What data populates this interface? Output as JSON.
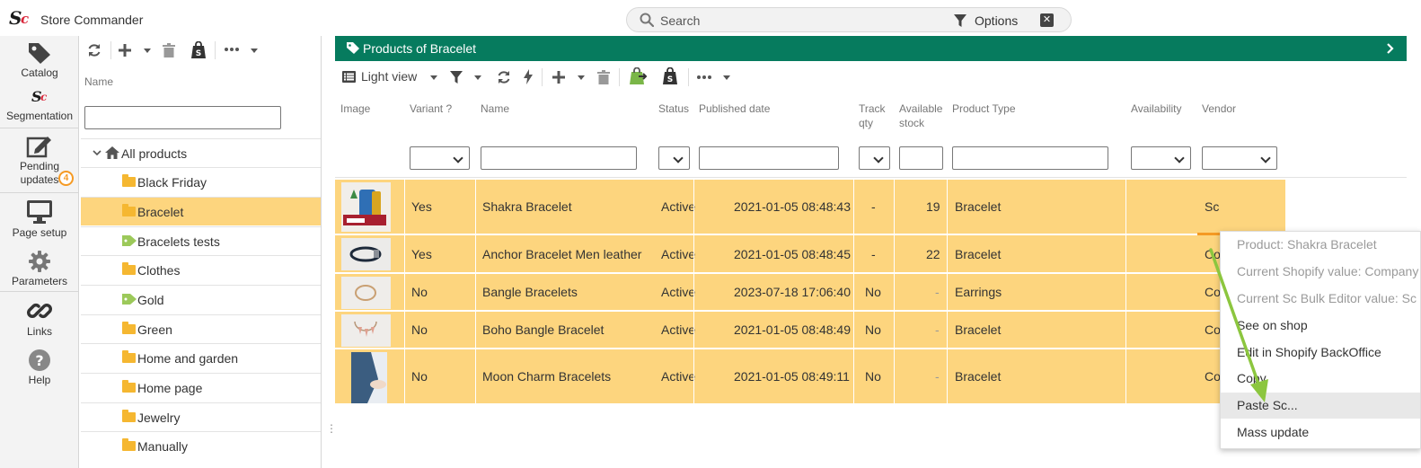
{
  "app": {
    "logo_s": "S",
    "logo_c": "c",
    "title": "Store Commander"
  },
  "search": {
    "placeholder": "Search",
    "options_label": "Options",
    "clear_glyph": "✕"
  },
  "rail": [
    {
      "label": "Catalog",
      "icon": "tag-icon"
    },
    {
      "label": "Segmentation",
      "icon": "sc-logo-icon"
    },
    {
      "label": "Pending updates",
      "icon": "edit-icon",
      "badge": "4"
    },
    {
      "label": "Page setup",
      "icon": "monitor-icon"
    },
    {
      "label": "Parameters",
      "icon": "gear-icon"
    },
    {
      "label": "Links",
      "icon": "link-icon"
    },
    {
      "label": "Help",
      "icon": "help-icon"
    }
  ],
  "tree": {
    "column_header": "Name",
    "filter_value": "",
    "root": "All products",
    "items": [
      {
        "label": "Black Friday",
        "icon": "folder-icon",
        "selected": false
      },
      {
        "label": "Bracelet",
        "icon": "folder-icon",
        "selected": true
      },
      {
        "label": "Bracelets tests",
        "icon": "tag-icon",
        "selected": false
      },
      {
        "label": "Clothes",
        "icon": "folder-icon",
        "selected": false
      },
      {
        "label": "Gold",
        "icon": "tag-icon",
        "selected": false
      },
      {
        "label": "Green",
        "icon": "folder-icon",
        "selected": false
      },
      {
        "label": "Home and garden",
        "icon": "folder-icon",
        "selected": false
      },
      {
        "label": "Home page",
        "icon": "folder-icon",
        "selected": false
      },
      {
        "label": "Jewelry",
        "icon": "folder-icon",
        "selected": false
      },
      {
        "label": "Manually",
        "icon": "folder-icon",
        "selected": false
      }
    ]
  },
  "products_panel": {
    "title": "Products of Bracelet",
    "view_label": "Light view",
    "columns": {
      "image": "Image",
      "variant": "Variant ?",
      "name": "Name",
      "status": "Status",
      "published": "Published date",
      "track_qty_1": "Track",
      "track_qty_2": "qty",
      "stock_1": "Available",
      "stock_2": "stock",
      "type": "Product Type",
      "availability": "Availability",
      "vendor": "Vendor"
    },
    "rows": [
      {
        "variant": "Yes",
        "name": "Shakra Bracelet",
        "status": "Active",
        "published": "2021-01-05 08:48:43",
        "track": "-",
        "stock": "19",
        "type": "Bracelet",
        "vendor": "Sc"
      },
      {
        "variant": "Yes",
        "name": "Anchor Bracelet Men leather",
        "status": "Active",
        "published": "2021-01-05 08:48:45",
        "track": "-",
        "stock": "22",
        "type": "Bracelet",
        "vendor": "Co"
      },
      {
        "variant": "No",
        "name": "Bangle Bracelets",
        "status": "Active",
        "published": "2023-07-18 17:06:40",
        "track": "No",
        "stock": "-",
        "type": "Earrings",
        "vendor": "Co"
      },
      {
        "variant": "No",
        "name": "Boho Bangle Bracelet",
        "status": "Active",
        "published": "2021-01-05 08:48:49",
        "track": "No",
        "stock": "-",
        "type": "Bracelet",
        "vendor": "Co"
      },
      {
        "variant": "No",
        "name": "Moon Charm Bracelets",
        "status": "Active",
        "published": "2021-01-05 08:49:11",
        "track": "No",
        "stock": "-",
        "type": "Bracelet",
        "vendor": "Co"
      }
    ]
  },
  "context_menu": {
    "items": [
      {
        "label": "Product: Shakra Bracelet",
        "enabled": false
      },
      {
        "label": "Current Shopify value: Company",
        "enabled": false
      },
      {
        "label": "Current Sc Bulk Editor value: Sc",
        "enabled": false
      },
      {
        "label": "See on shop",
        "enabled": true
      },
      {
        "label": "Edit in Shopify BackOffice",
        "enabled": true
      },
      {
        "label": "Copy",
        "enabled": true
      },
      {
        "label": "Paste Sc...",
        "enabled": true,
        "highlighted": true
      },
      {
        "label": "Mass update",
        "enabled": true
      }
    ]
  },
  "colors": {
    "header_green": "#067b5e",
    "selection_yellow": "#fdd57e",
    "accent_orange": "#f59a23",
    "arrow_green": "#8cc63f"
  }
}
